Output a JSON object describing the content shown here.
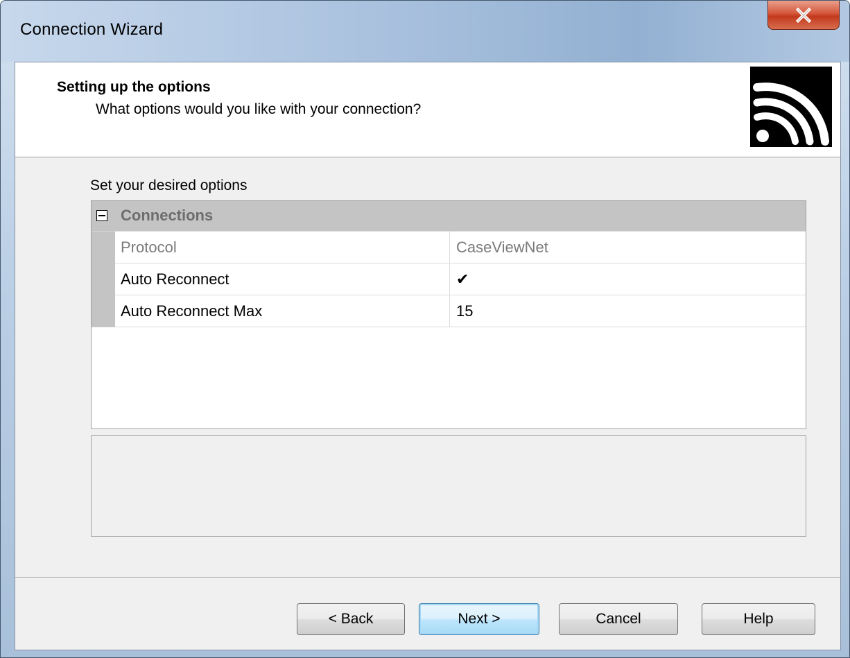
{
  "window": {
    "title": "Connection Wizard",
    "close_glyph": "X"
  },
  "header": {
    "title": "Setting up the options",
    "subtitle": "What options would you like with your connection?",
    "logo_icon": "wifi-signal-icon"
  },
  "main": {
    "prompt": "Set your desired options",
    "property_grid": {
      "category": {
        "label": "Connections",
        "expander_glyph": "⊟",
        "expanded": true
      },
      "rows": [
        {
          "name": "Protocol",
          "value": "CaseViewNet",
          "readonly": true
        },
        {
          "name": "Auto Reconnect",
          "value": "✔",
          "readonly": false
        },
        {
          "name": "Auto Reconnect Max",
          "value": "15",
          "readonly": false
        }
      ]
    },
    "description": ""
  },
  "buttons": {
    "back": "< Back",
    "next": "Next >",
    "cancel": "Cancel",
    "help": "Help"
  },
  "colors": {
    "category_band": "#c4c4c4",
    "default_button_border": "#3c7fb1",
    "close_button": "#c2391d"
  }
}
